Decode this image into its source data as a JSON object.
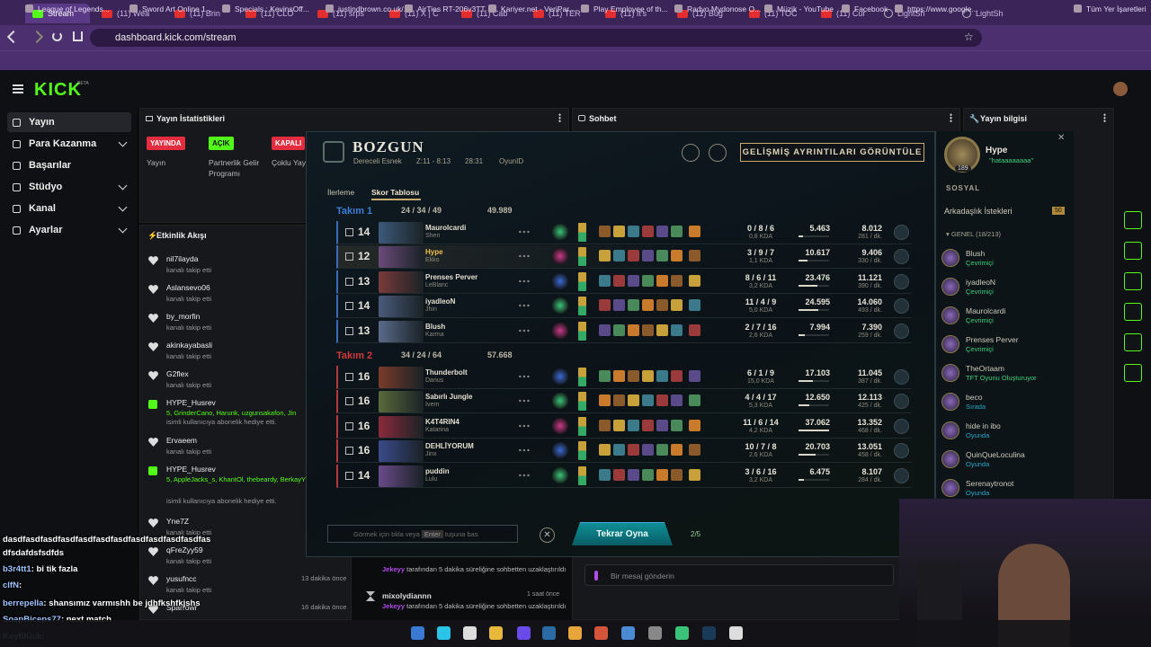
{
  "browser": {
    "tabs": [
      "Stream",
      "(11) Wea",
      "(11) Brin",
      "(11) CLO",
      "(11) srps",
      "(11) X | C",
      "(11) Cab",
      "(11) TER",
      "(11) It's",
      "(11) Buğ",
      "(11) TOC",
      "(11) Cur",
      "LightSh",
      "LightSh"
    ],
    "url": "dashboard.kick.com/stream",
    "bookmarks": [
      "League of Legends...",
      "Sword Art Online 1...",
      "Specials : KevinsOff...",
      "justindbrown.co.uk/...",
      "AirTies RT-206v3TT",
      "Kariyer.net - VeriPar...",
      "Play Employee of th...",
      "Radyo Mydonose O...",
      "Müzik - YouTube",
      "Facebook",
      "https://www.google...",
      "Tüm Yer İşaretleri"
    ]
  },
  "kick": {
    "logo": "KICK",
    "beta": "BETA",
    "nav": [
      {
        "label": "Yayın",
        "icon": "broadcast-icon"
      },
      {
        "label": "Para Kazanma",
        "icon": "money-icon"
      },
      {
        "label": "Başarılar",
        "icon": "trophy-icon"
      },
      {
        "label": "Stüdyo",
        "icon": "studio-icon"
      },
      {
        "label": "Kanal",
        "icon": "channel-icon"
      },
      {
        "label": "Ayarlar",
        "icon": "settings-icon"
      }
    ],
    "stats_title": "Yayın İstatistikleri",
    "stats": [
      {
        "badge": "YAYINDA",
        "label": "Yayın",
        "color": "#e52d3f"
      },
      {
        "badge": "AÇIK",
        "label": "Partnerlik Gelir Programı",
        "color": "#53fc18"
      },
      {
        "badge": "KAPALI",
        "label": "Çoklu Yay",
        "color": "#e52d3f"
      }
    ],
    "chat_title": "Sohbet",
    "info_title": "Yayın bilgisi",
    "activity_title": "Etkinlik Akışı",
    "activity": [
      {
        "name": "nil7ilayda",
        "sub": "kanalı takip etti",
        "ago": ""
      },
      {
        "name": "Aslansevo06",
        "sub": "kanalı takip etti",
        "ago": ""
      },
      {
        "name": "by_morfin",
        "sub": "kanalı takip etti",
        "ago": ""
      },
      {
        "name": "akinkayabasli",
        "sub": "kanalı takip etti",
        "ago": ""
      },
      {
        "name": "G2flex",
        "sub": "kanalı takip etti",
        "ago": ""
      },
      {
        "name": "HYPE_Husrev",
        "sub": "5, GrinderCano, Harunk, uzgunsakafon, Jin",
        "sub2": "isimli kullanıcıya abonelik hediye etti.",
        "ago": ""
      },
      {
        "name": "Ervaeem",
        "sub": "kanalı takip etti",
        "ago": ""
      },
      {
        "name": "HYPE_Husrev",
        "sub": "5, AppleJacks_s, KhantOl, thebeardy, BerkayYil Muratlll",
        "sub2": "isimli kullanıcıya abonelik hediye etti.",
        "ago": ""
      },
      {
        "name": "Yne7Z",
        "sub": "kanalı takip etti",
        "ago": ""
      },
      {
        "name": "qFreZyy59",
        "sub": "kanalı takip etti",
        "ago": ""
      },
      {
        "name": "yusufncc",
        "sub": "kanalı takip etti",
        "ago": "13 dakika önce"
      },
      {
        "name": "Sparrowr",
        "sub": "",
        "ago": "16 dakika önce"
      }
    ],
    "chat_feed": [
      {
        "user": "Jekeyy",
        "text": "tarafından 5 dakika süreliğine sohbetten uzaklaştırıldı"
      },
      {
        "user": "mixolydiannn",
        "text": "1 saat önce"
      },
      {
        "user": "Jekeyy",
        "text": "tarafından 5 dakika süreliğine sohbetten uzaklaştırıldı"
      }
    ],
    "chat_placeholder": "Bir mesaj gönderin"
  },
  "game": {
    "title": "BOZGUN",
    "mode": "Dereceli Esnek",
    "time": "Z:11 - 8:13",
    "duration": "28:31",
    "game_id": "OyunID",
    "details_button": "GELİŞMİŞ AYRINTILARI GÖRÜNTÜLE",
    "tabs": [
      "İlerleme",
      "Skor Tablosu"
    ],
    "team1": {
      "name": "Takım 1",
      "kda": "24 / 34 / 49",
      "gold": "49.989",
      "color": "#3a7fd5"
    },
    "team2": {
      "name": "Takım 2",
      "kda": "34 / 24 / 64",
      "gold": "57.668",
      "color": "#d0383a"
    },
    "players": [
      {
        "team": 1,
        "lvl": "14",
        "name": "Maurolcardi",
        "champ": "Shen",
        "kda": "0 / 8 / 6",
        "kdr": "0,8 KDA",
        "dmg": "5.463",
        "dmgf": 0.15,
        "gold": "8.012",
        "gpm": "281 / dk.",
        "col": "#3d5a7a"
      },
      {
        "team": 1,
        "lvl": "12",
        "name": "Hype",
        "champ": "Ekko",
        "kda": "3 / 9 / 7",
        "kdr": "1,1 KDA",
        "dmg": "10.617",
        "dmgf": 0.29,
        "gold": "9.406",
        "gpm": "330 / dk.",
        "col": "#6a4a7a",
        "me": true
      },
      {
        "team": 1,
        "lvl": "13",
        "name": "Prenses Perver",
        "champ": "LeBlanc",
        "kda": "8 / 6 / 11",
        "kdr": "3,2 KDA",
        "dmg": "23.476",
        "dmgf": 0.63,
        "gold": "11.121",
        "gpm": "390 / dk.",
        "col": "#7a3a3a"
      },
      {
        "team": 1,
        "lvl": "14",
        "name": "iyadleoN",
        "champ": "Jhin",
        "kda": "11 / 4 / 9",
        "kdr": "5,0 KDA",
        "dmg": "24.595",
        "dmgf": 0.66,
        "gold": "14.060",
        "gpm": "493 / dk.",
        "col": "#4a5a7a"
      },
      {
        "team": 1,
        "lvl": "13",
        "name": "Blush",
        "champ": "Karma",
        "kda": "2 / 7 / 16",
        "kdr": "2,6 KDA",
        "dmg": "7.994",
        "dmgf": 0.22,
        "gold": "7.390",
        "gpm": "259 / dk.",
        "col": "#5a6a8a"
      },
      {
        "team": 2,
        "lvl": "16",
        "name": "Thunderbolt",
        "champ": "Darius",
        "kda": "6 / 1 / 9",
        "kdr": "15,0 KDA",
        "dmg": "17.103",
        "dmgf": 0.46,
        "gold": "11.045",
        "gpm": "387 / dk.",
        "col": "#7a3a2a"
      },
      {
        "team": 2,
        "lvl": "16",
        "name": "Sabırlı Jungle",
        "champ": "Ivern",
        "kda": "4 / 4 / 17",
        "kdr": "5,3 KDA",
        "dmg": "12.650",
        "dmgf": 0.34,
        "gold": "12.113",
        "gpm": "425 / dk.",
        "col": "#5a6a3a"
      },
      {
        "team": 2,
        "lvl": "16",
        "name": "K4T4RIN4",
        "champ": "Katarina",
        "kda": "11 / 6 / 14",
        "kdr": "4,2 KDA",
        "dmg": "37.062",
        "dmgf": 1.0,
        "gold": "13.352",
        "gpm": "468 / dk.",
        "col": "#8a2a3a"
      },
      {
        "team": 2,
        "lvl": "16",
        "name": "DEHLİYORUM",
        "champ": "Jinx",
        "kda": "10 / 7 / 8",
        "kdr": "2,6 KDA",
        "dmg": "20.703",
        "dmgf": 0.56,
        "gold": "13.051",
        "gpm": "458 / dk.",
        "col": "#3a4a8a"
      },
      {
        "team": 2,
        "lvl": "14",
        "name": "puddin",
        "champ": "Lulu",
        "kda": "3 / 6 / 16",
        "kdr": "3,2 KDA",
        "dmg": "6.475",
        "dmgf": 0.17,
        "gold": "8.107",
        "gpm": "284 / dk.",
        "col": "#6a4a8a"
      }
    ],
    "chat_placeholder": "Görmek için tıkla veya",
    "enter_key": "Enter",
    "chat_suffix": "tuşuna bas",
    "play_again": "Tekrar Oyna",
    "party": "2/5"
  },
  "social": {
    "me": "Hype",
    "status": "\"hataaaaaaaa\"",
    "level": "189",
    "section": "SOSYAL",
    "requests": "Arkadaşlık İstekleri",
    "requests_count": "50",
    "group": "GENEL (18/213)",
    "friends": [
      {
        "name": "Blush",
        "status": "Çevrimiçi",
        "type": "g"
      },
      {
        "name": "iyadleoN",
        "status": "Çevrimiçi",
        "type": "g"
      },
      {
        "name": "Maurolcardi",
        "status": "Çevrimiçi",
        "type": "g"
      },
      {
        "name": "Prenses Perver",
        "status": "Çevrimiçi",
        "type": "g"
      },
      {
        "name": "TheOrtaam",
        "status": "TFT Oyunu Oluşturuyor",
        "type": "g"
      },
      {
        "name": "beco",
        "status": "Sırada",
        "type": "b"
      },
      {
        "name": "hide in ibo",
        "status": "Oyunda",
        "type": "b"
      },
      {
        "name": "QuinQueLoculina",
        "status": "Oyunda",
        "type": "b"
      },
      {
        "name": "Serenaytronot",
        "status": "Oyunda",
        "type": "b"
      }
    ]
  },
  "stream_chat": [
    {
      "user": "",
      "text": "dasdfasdfasdfasdfasdfasdfasdfasdfasdfasdfasdfas"
    },
    {
      "user": "",
      "text": "dfsdafdsfsdfds"
    },
    {
      "user": "b3r4tt1",
      "text": ": bi tik fazla"
    },
    {
      "user": "clfN",
      "text": ":"
    },
    {
      "user": "berrepella",
      "text": ": shansımız varmıshh be jdhfkshfkjshs"
    },
    {
      "user": "SoapBiceps77",
      "text": ": next match"
    },
    {
      "user": "KeyfiKick",
      "text": ":"
    }
  ]
}
